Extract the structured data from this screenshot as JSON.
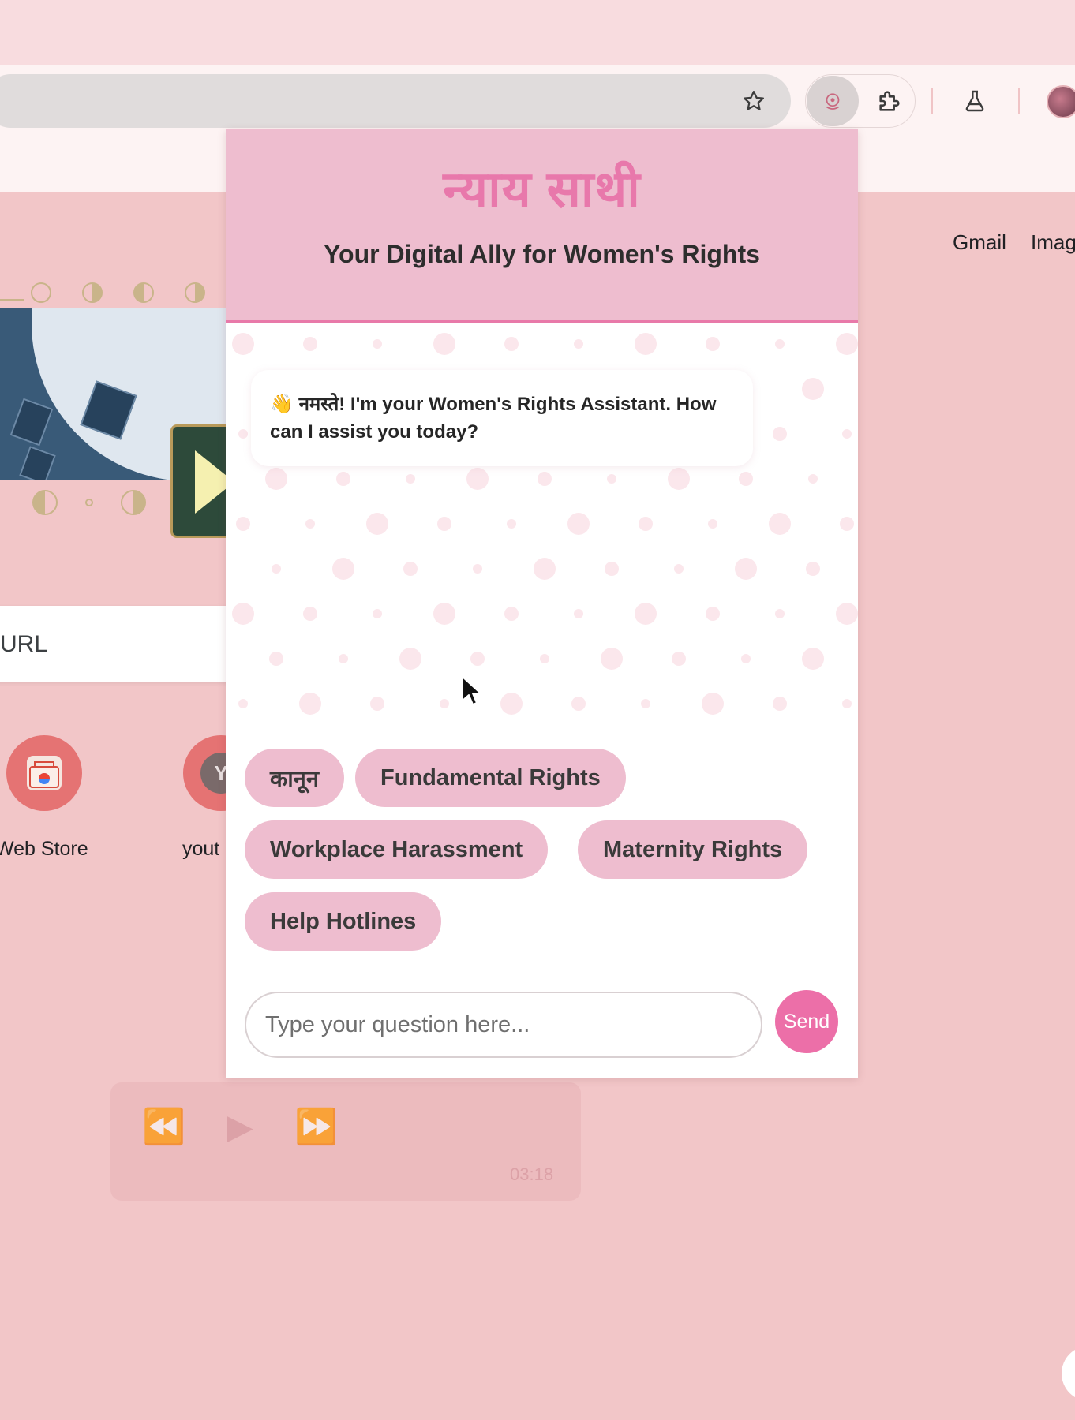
{
  "browser": {
    "icons": {
      "bookmark": "star-icon",
      "active_extension": "nyay-sathi-extension-icon",
      "extensions": "puzzle-icon",
      "labs": "flask-icon",
      "profile": "avatar"
    }
  },
  "google": {
    "top_links": [
      "Gmail",
      "Imag"
    ],
    "search_placeholder_fragment": "URL",
    "shortcuts": [
      {
        "label": "Web Store",
        "icon": "chrome-web-store-icon"
      },
      {
        "label": "yout",
        "icon": "youtube-letter-icon",
        "letter": "Y"
      }
    ],
    "media_time": "03:18"
  },
  "popup": {
    "title": "न्याय साथी",
    "subtitle": "Your Digital Ally for Women's Rights",
    "greeting": {
      "emoji": "👋",
      "text": "नमस्ते! I'm your Women's Rights Assistant. How can I assist you today?"
    },
    "quick_topics": [
      "कानून",
      "Fundamental Rights",
      "Workplace Harassment",
      "Maternity Rights",
      "Help Hotlines"
    ],
    "input": {
      "placeholder": "Type your question here...",
      "value": ""
    },
    "send_label": "Send"
  },
  "colors": {
    "page_background": "#f2c6c8",
    "popup_header": "#eebdcf",
    "accent_pink": "#e878ab",
    "send_button": "#ec6fa8",
    "chip_background": "#eebdcf"
  }
}
